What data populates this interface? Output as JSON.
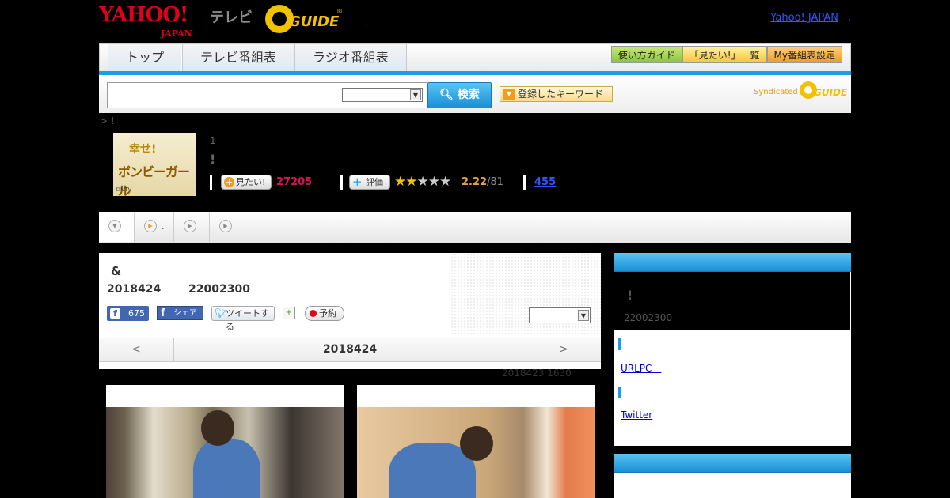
{
  "header": {
    "yahoo_logo": "YAHOO!",
    "yahoo_logo_sub": "JAPAN",
    "tv_label": "テレビ",
    "gguide_logo": "GUIDE",
    "gguide_reg": "®",
    "comma": ",",
    "yahoo_japan_link": "Yahoo! JAPAN",
    "yahoo_japan_link_dot": "."
  },
  "nav": {
    "tabs": [
      {
        "label": "トップ"
      },
      {
        "label": "テレビ番組表"
      },
      {
        "label": "ラジオ番組表"
      }
    ],
    "guide_button": "使い方ガイド",
    "mitai_list_button": "「見たい!」一覧",
    "my_schedule_button": "My番組表設定"
  },
  "search": {
    "button_label": "検索",
    "keyword_button": "登録したキーワード",
    "syndicated": "Syndicated",
    "syndicated_logo": "GUIDE"
  },
  "breadcrumb": "> !",
  "program": {
    "thumb_line1": "幸せ!",
    "thumb_line2": "ボンビーガール",
    "thumb_credit": "©NTV",
    "episode_number": "1",
    "title": "!",
    "mitai_label": "見たい!",
    "mitai_count": "27205",
    "hyoka_label": "評価",
    "rating": "2.22",
    "rating_total": "/81",
    "review_count": "455",
    "stars_filled": 2,
    "stars_total": 5
  },
  "subnav": {
    "tab2_label": "."
  },
  "episode": {
    "title": "&",
    "date": "2018424",
    "time": "22002300",
    "fb_like_count": "675",
    "fb_share": "シェア",
    "tweet": "ツイートする",
    "yoyaku": "予約",
    "pager_prev": "<",
    "pager_current": "2018424",
    "pager_next": ">",
    "updated": "2018423  1630"
  },
  "sidebar": {
    "bang": "!",
    "time": "22002300",
    "url_link": "URLPC　",
    "twitter_link": "Twitter"
  },
  "colors": {
    "accent_blue": "#1b9de2",
    "mitai_pink": "#d4145a",
    "rating_orange": "#e8a33c"
  }
}
